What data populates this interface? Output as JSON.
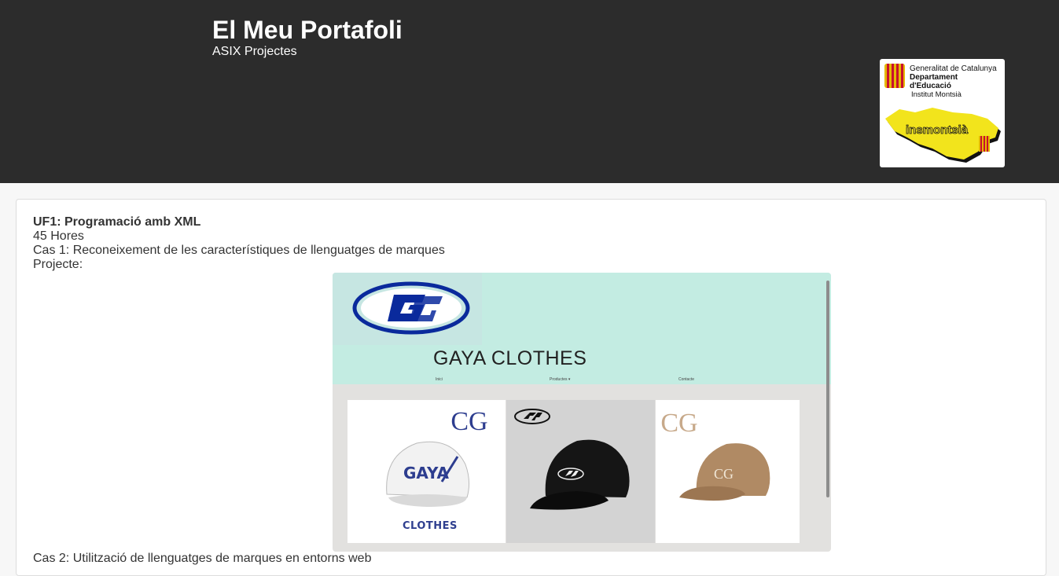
{
  "header": {
    "title": "El Meu Portafoli",
    "subtitle": "ASIX Projectes"
  },
  "logo": {
    "line1": "Generalitat de Catalunya",
    "line2": "Departament",
    "line3": "d'Educació",
    "institut": "Institut Montsià",
    "badge": "insmontsià"
  },
  "content": {
    "uf_title": "UF1: Programació amb XML",
    "hours": "45 Hores",
    "cas1": "Cas 1: Reconeixement de les característiques de llenguatges de marques",
    "project_label": "Projecte:",
    "cas2": "Cas 2: Utilització de llenguatges de marques en entorns web"
  },
  "project_preview": {
    "brand": "GAYA CLOTHES",
    "nav": [
      "Inici",
      "Productes ▾",
      "Contacte"
    ],
    "cap_text": "GAYA",
    "clothes": "CLOTHES",
    "monogram": "CG"
  },
  "colors": {
    "header_bg": "#2c2c2c",
    "preview_band": "#c3ece2",
    "brand_blue": "#0a2a9c"
  }
}
